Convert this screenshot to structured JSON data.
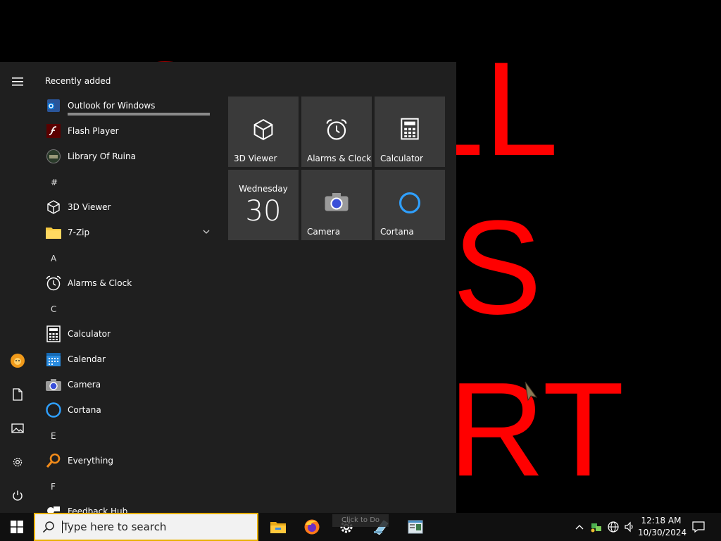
{
  "wallpaper": {
    "letters": [
      {
        "text": "SMALL",
        "row": 1
      },
      {
        "text": "IS",
        "row": 2
      },
      {
        "text": "ART",
        "row": 3
      }
    ]
  },
  "start_menu": {
    "recent_header": "Recently added",
    "recent_progress": 1.0,
    "recent": [
      {
        "label": "Outlook for Windows",
        "icon": "outlook-icon"
      },
      {
        "label": "Flash Player",
        "icon": "flash-player-icon"
      },
      {
        "label": "Library Of Ruina",
        "icon": "library-of-ruina-icon"
      }
    ],
    "sections": [
      {
        "letter": "#",
        "apps": [
          {
            "label": "3D Viewer",
            "icon": "cube-icon"
          },
          {
            "label": "7-Zip",
            "icon": "folder-icon",
            "expandable": true
          }
        ]
      },
      {
        "letter": "A",
        "apps": [
          {
            "label": "Alarms & Clock",
            "icon": "alarm-clock-icon"
          }
        ]
      },
      {
        "letter": "C",
        "apps": [
          {
            "label": "Calculator",
            "icon": "calculator-icon"
          },
          {
            "label": "Calendar",
            "icon": "calendar-icon"
          },
          {
            "label": "Camera",
            "icon": "camera-icon"
          },
          {
            "label": "Cortana",
            "icon": "cortana-icon"
          }
        ]
      },
      {
        "letter": "E",
        "apps": [
          {
            "label": "Everything",
            "icon": "magnifier-icon"
          }
        ]
      },
      {
        "letter": "F",
        "apps": [
          {
            "label": "Feedback Hub",
            "icon": "feedback-icon"
          }
        ]
      }
    ],
    "tiles": [
      {
        "label": "3D Viewer",
        "icon": "cube-icon"
      },
      {
        "label": "Alarms & Clock",
        "icon": "alarm-clock-icon"
      },
      {
        "label": "Calculator",
        "icon": "calculator-icon"
      },
      {
        "label": "",
        "icon": "calendar-live-tile",
        "day_name": "Wednesday",
        "day_number": "30"
      },
      {
        "label": "Camera",
        "icon": "camera-icon"
      },
      {
        "label": "Cortana",
        "icon": "cortana-icon"
      }
    ],
    "rail": [
      "hamburger-menu-icon",
      "user-avatar-icon",
      "documents-icon",
      "pictures-icon",
      "settings-icon",
      "power-icon"
    ]
  },
  "taskbar": {
    "search_placeholder": "Type here to search",
    "pinned": [
      "file-explorer-icon",
      "firefox-icon",
      "settings-gear-icon",
      "notepad-icon",
      "app-window-icon"
    ],
    "tooltip": "Click to Do",
    "tray": [
      "chevron-up-icon",
      "network-status-icon",
      "globe-icon",
      "volume-icon"
    ],
    "time": "12:18 AM",
    "date": "10/30/2024",
    "notification_icon": "notification-icon"
  },
  "colors": {
    "wallpaper_text": "#ff0000",
    "menu_bg": "#1f1f1f",
    "tile_bg": "#3a3a3a",
    "accent_blue": "#2fa0ff",
    "search_border": "#e8b100"
  }
}
